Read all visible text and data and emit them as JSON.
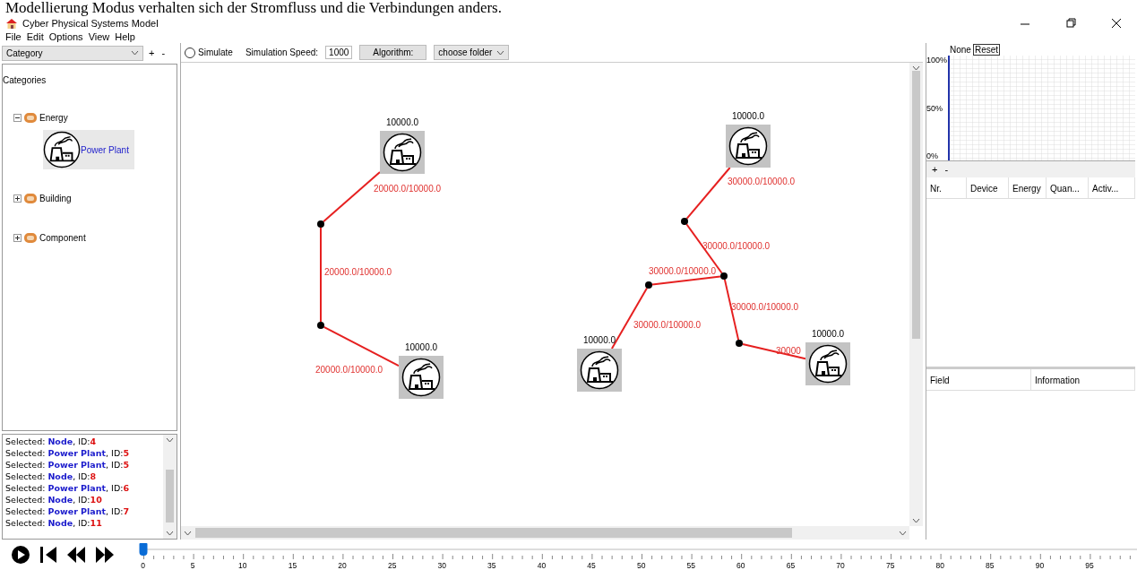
{
  "heading": "Modellierung Modus verhalten sich der Stromfluss und die Verbindungen anders.",
  "window": {
    "title": "Cyber Physical Systems Model"
  },
  "menu": [
    "File",
    "Edit",
    "Options",
    "View",
    "Help"
  ],
  "category_select": {
    "value": "Category"
  },
  "category_buttons": [
    "+",
    "-"
  ],
  "tree": {
    "title": "Categories",
    "items": [
      {
        "label": "Energy",
        "expanded": true,
        "children": [
          {
            "label": "Power Plant",
            "selected": true
          }
        ]
      },
      {
        "label": "Building",
        "expanded": false
      },
      {
        "label": "Component",
        "expanded": false
      }
    ]
  },
  "log": [
    {
      "prefix": "Selected:",
      "object": "Node",
      "id_label": ", ID:",
      "id": "4"
    },
    {
      "prefix": "Selected:",
      "object": "Power Plant",
      "id_label": ", ID:",
      "id": "5"
    },
    {
      "prefix": "Selected:",
      "object": "Power Plant",
      "id_label": ", ID:",
      "id": "5"
    },
    {
      "prefix": "Selected:",
      "object": "Node",
      "id_label": ", ID:",
      "id": "8"
    },
    {
      "prefix": "Selected:",
      "object": "Power Plant",
      "id_label": ", ID:",
      "id": "6"
    },
    {
      "prefix": "Selected:",
      "object": "Node",
      "id_label": ", ID:",
      "id": "10"
    },
    {
      "prefix": "Selected:",
      "object": "Power Plant",
      "id_label": ", ID:",
      "id": "7"
    },
    {
      "prefix": "Selected:",
      "object": "Node",
      "id_label": ", ID:",
      "id": "11"
    }
  ],
  "toolbar": {
    "simulate": {
      "label": "Simulate",
      "checked": false
    },
    "speed_label": "Simulation Speed:",
    "speed_value": "1000",
    "algorithm_button": "Algorithm:",
    "folder_select": "choose folder"
  },
  "canvas": {
    "elements": [
      {
        "kind": "plant",
        "value": "10000.0"
      },
      {
        "kind": "plant",
        "value": "10000.0"
      },
      {
        "kind": "plant",
        "value": "10000.0"
      },
      {
        "kind": "plant",
        "value": "10000.0"
      },
      {
        "kind": "plant",
        "value": "10000.0"
      },
      {
        "kind": "node"
      },
      {
        "kind": "node"
      },
      {
        "kind": "node"
      },
      {
        "kind": "node"
      },
      {
        "kind": "node"
      },
      {
        "kind": "node"
      }
    ],
    "edges": [
      {
        "label": "20000.0/10000.0"
      },
      {
        "label": "20000.0/10000.0"
      },
      {
        "label": "20000.0/10000.0"
      },
      {
        "label": "30000.0/10000.0"
      },
      {
        "label": "30000.0/10000.0"
      },
      {
        "label": "30000.0/10000.0"
      },
      {
        "label": "30000.0/10000.0"
      },
      {
        "label": "30000.0/10000.0"
      },
      {
        "label": "30000"
      }
    ]
  },
  "chart_panel": {
    "series_label": "None",
    "reset_button": "Reset",
    "y_labels": [
      "100%",
      "50%",
      "0%"
    ]
  },
  "device_table": {
    "buttons": [
      "+",
      "-"
    ],
    "columns": [
      "Nr.",
      "Device",
      "Energy",
      "Quan...",
      "Activ..."
    ]
  },
  "info_table": {
    "columns": [
      "Field",
      "Information"
    ]
  },
  "timeline": {
    "level": 0,
    "labels": [
      "0",
      "5",
      "10",
      "15",
      "20",
      "25",
      "30",
      "35",
      "40",
      "45",
      "50",
      "55",
      "60",
      "65",
      "70",
      "75",
      "80",
      "85",
      "90",
      "95"
    ]
  }
}
